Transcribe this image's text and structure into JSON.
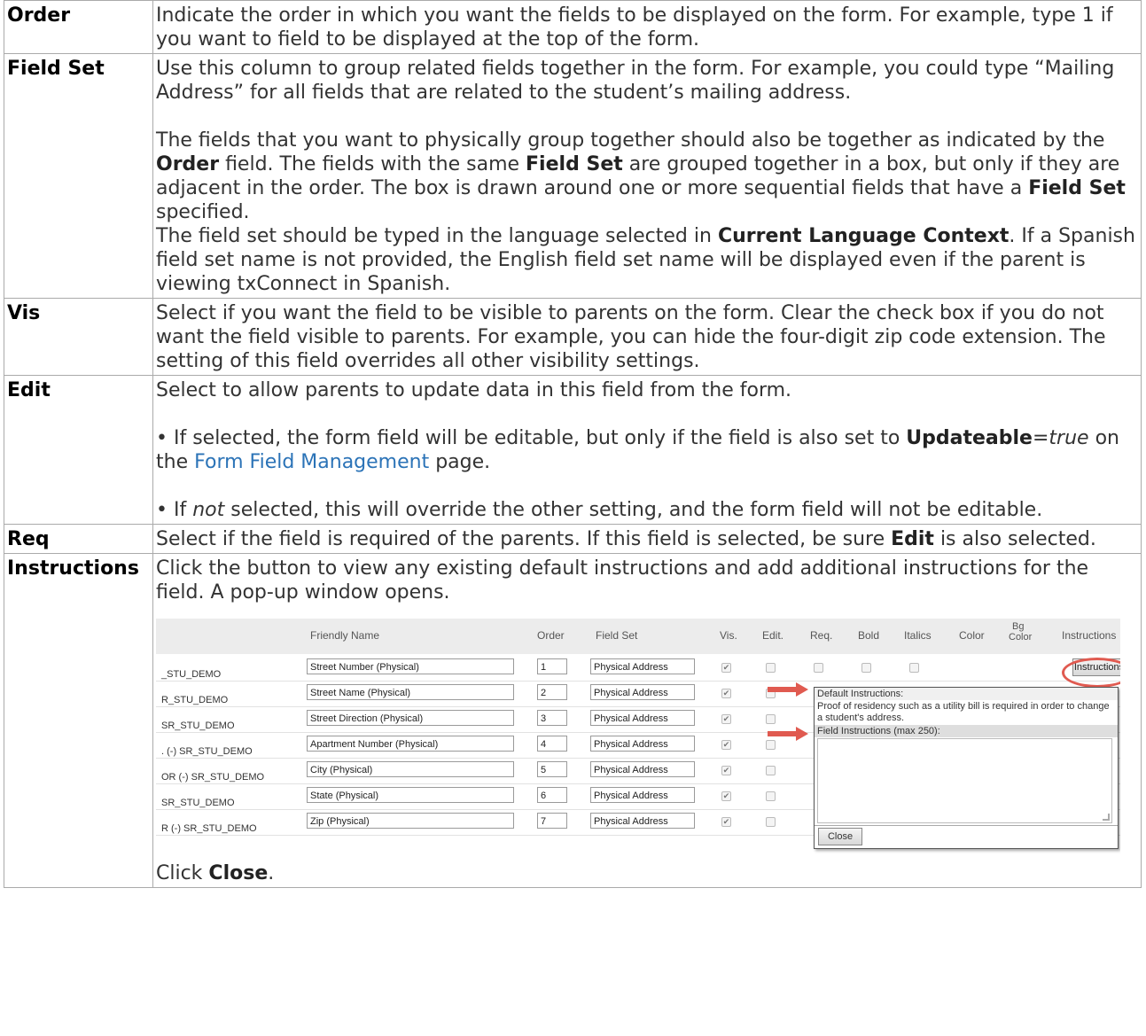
{
  "rows": [
    {
      "term": "Order",
      "paragraphs": [
        "Indicate the order in which you want the fields to be displayed on the form. For example, type 1 if you want to field to be displayed at the top of the form."
      ]
    },
    {
      "term": "Field Set",
      "p1": "Use this column to group related fields together in the form. For example, you could type “Mailing Address” for all fields that are related to the student’s mailing address.",
      "p2_a": "The fields that you want to physically group together should also be together as indicated by the ",
      "p2_b1": "Order",
      "p2_c": " field. The fields with the same ",
      "p2_b2": "Field Set",
      "p2_d": " are grouped together in a box, but only if they are adjacent in the order. The box is drawn around one or more sequential fields that have a ",
      "p2_b3": "Field Set",
      "p2_e": " specified.",
      "p3_a": "The field set should be typed in the language selected in ",
      "p3_b": "Current Language Context",
      "p3_c": ". If a Spanish field set name is not provided, the English field set name will be displayed even if the parent is viewing txConnect in Spanish."
    },
    {
      "term": "Vis",
      "p1": "Select if you want the field to be visible to parents on the form. Clear the check box if you do not want the field visible to parents. For example, you can hide the four-digit zip code extension. The setting of this field overrides all other visibility settings."
    },
    {
      "term": "Edit",
      "p1": "Select to allow parents to update data in this field from the form.",
      "p2_a": "• If selected, the form field will be editable, but only if the field is also set to ",
      "p2_b": "Updateable",
      "p2_c": "=",
      "p2_i": "true",
      "p2_d": " on the ",
      "p2_link": "Form Field Management",
      "p2_e": " page.",
      "p3_a": "• If ",
      "p3_i": "not",
      "p3_b": " selected, this will override the other setting, and the form field will not be editable."
    },
    {
      "term": "Req",
      "p1_a": "Select if the field is required of the parents. If this field is selected, be sure ",
      "p1_b": "Edit",
      "p1_c": " is also selected."
    },
    {
      "term": "Instructions",
      "p1": "Click the button to view any existing default instructions and add additional instructions for the field. A pop-up window opens.",
      "p_close_a": "Click ",
      "p_close_b": "Close",
      "p_close_c": "."
    }
  ],
  "screenshot": {
    "headers": {
      "friendly_name": "Friendly Name",
      "order": "Order",
      "field_set": "Field Set",
      "vis": "Vis.",
      "edit": "Edit.",
      "req": "Req.",
      "bold": "Bold",
      "italics": "Italics",
      "color": "Color",
      "bg_color_1": "Bg",
      "bg_color_2": "Color",
      "instructions": "Instructions"
    },
    "rows": [
      {
        "table": "_STU_DEMO",
        "name": "Street Number (Physical)",
        "order": "1",
        "field_set": "Physical Address"
      },
      {
        "table": "R_STU_DEMO",
        "name": "Street Name (Physical)",
        "order": "2",
        "field_set": "Physical Address"
      },
      {
        "table": "SR_STU_DEMO",
        "name": "Street Direction (Physical)",
        "order": "3",
        "field_set": "Physical Address"
      },
      {
        "table": ". (-) SR_STU_DEMO",
        "name": "Apartment Number (Physical)",
        "order": "4",
        "field_set": "Physical Address"
      },
      {
        "table": "OR (-) SR_STU_DEMO",
        "name": "City (Physical)",
        "order": "5",
        "field_set": "Physical Address"
      },
      {
        "table": "SR_STU_DEMO",
        "name": "State (Physical)",
        "order": "6",
        "field_set": "Physical Address"
      },
      {
        "table": "R (-) SR_STU_DEMO",
        "name": "Zip (Physical)",
        "order": "7",
        "field_set": "Physical Address"
      }
    ],
    "instructions_button": "Instructions",
    "popup": {
      "default_title": "Default Instructions:",
      "default_text": "Proof of residency such as a utility bill is required in order to change a student's address.",
      "field_title": "Field Instructions (max 250):",
      "close_button": "Close"
    },
    "accent_color": "#e05a50"
  }
}
